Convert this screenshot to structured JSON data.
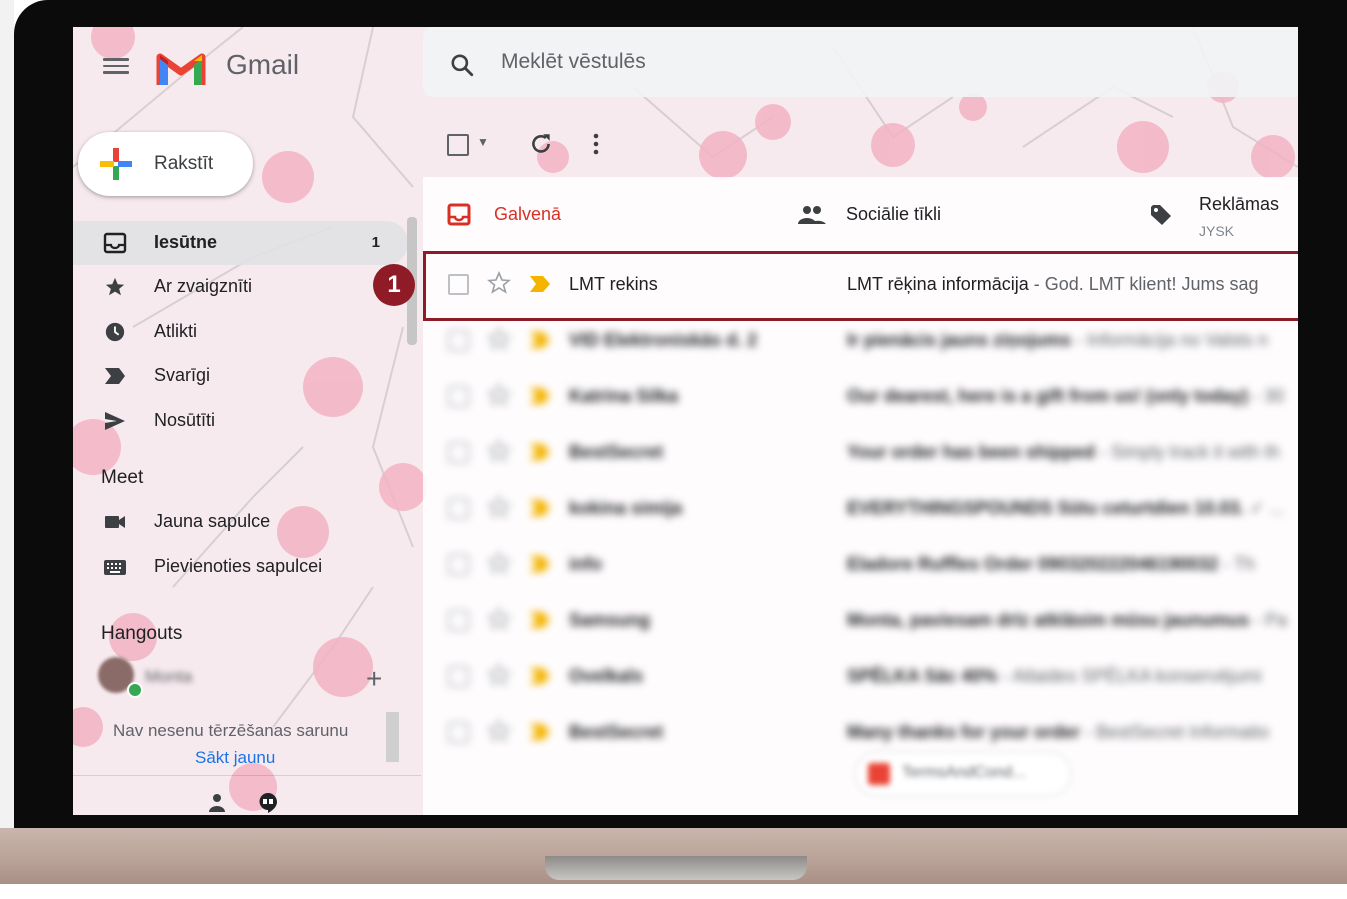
{
  "app": {
    "name": "Gmail"
  },
  "search": {
    "placeholder": "Meklēt vēstulēs",
    "value": ""
  },
  "compose": {
    "label": "Rakstīt"
  },
  "sidebar": {
    "items": [
      {
        "label": "Iesūtne",
        "count": "1",
        "icon": "inbox-icon",
        "active": true
      },
      {
        "label": "Ar zvaigznīti",
        "icon": "star-icon"
      },
      {
        "label": "Atlikti",
        "icon": "clock-icon"
      },
      {
        "label": "Svarīgi",
        "icon": "important-icon"
      },
      {
        "label": "Nosūtīti",
        "icon": "send-icon"
      }
    ],
    "meet": {
      "title": "Meet",
      "items": [
        {
          "label": "Jauna sapulce",
          "icon": "video-icon"
        },
        {
          "label": "Pievienoties sapulcei",
          "icon": "keyboard-icon"
        }
      ]
    },
    "hangouts": {
      "title": "Hangouts",
      "no_chats": "Nav nesenu tērzēšanas sarunu",
      "start_new": "Sākt jaunu"
    }
  },
  "tabs": [
    {
      "label": "Galvenā",
      "icon": "inbox-icon",
      "active": true
    },
    {
      "label": "Sociālie tīkli",
      "icon": "people-icon"
    },
    {
      "label": "Reklāmas",
      "sublabel": "JYSK",
      "icon": "tag-icon"
    }
  ],
  "emails": [
    {
      "sender": "LMT rekins",
      "subject": "LMT rēķina informācija",
      "snippet": " - God. LMT klient! Jums sag",
      "highlighted": true
    },
    {
      "sender": "VID Elektroniskās d. 2",
      "subject": "Ir pienācis jauns ziņojums",
      "snippet": " - Informācija no Valsts n"
    },
    {
      "sender": "Katrina Silka",
      "subject": "Our dearest, here is a gift from us! (only today)",
      "snippet": " - 30"
    },
    {
      "sender": "BestSecret",
      "subject": "Your order has been shipped",
      "snippet": " - Simply track it with th"
    },
    {
      "sender": "kokina simija",
      "subject": "EVERYTHINGSPOUNDS Sūtu ceturtdien 10.03.",
      "snippet": " ✓ ..."
    },
    {
      "sender": "info",
      "subject": "Eladore Ruffles Order 090320222046190032",
      "snippet": " - Th"
    },
    {
      "sender": "Samsung",
      "subject": "Monta, paviesam drīz atklāsim mūsu jaunumus",
      "snippet": " - Pa"
    },
    {
      "sender": "Ovelkals",
      "subject": "SPĒLKA Sāc 40%",
      "snippet": " - Atlaides SPĒLKA konservējumi"
    },
    {
      "sender": "BestSecret",
      "subject": "Many thanks for your order",
      "snippet": " - BestSecret Informatio",
      "attachment": "TermsAndCond..."
    }
  ],
  "hangout_contact": "Monta",
  "step_badge": "1",
  "colors": {
    "accent_red": "#d93025",
    "highlight": "#8e1b26",
    "link": "#1a73e8",
    "important": "#f4b400"
  }
}
